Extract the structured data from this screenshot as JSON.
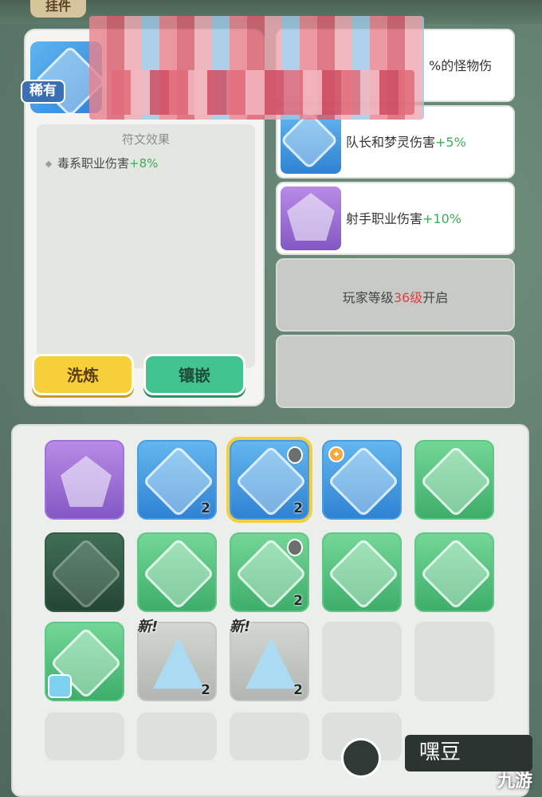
{
  "top": {
    "tab_label": "挂件"
  },
  "detail": {
    "rarity": "稀有",
    "effect_title": "符文效果",
    "effect_text": "毒系职业伤害",
    "effect_value": "+8%",
    "btn_refine": "洗炼",
    "btn_inlay": "镶嵌"
  },
  "slots": [
    {
      "text": "%的怪物伤",
      "value": ""
    },
    {
      "text": "队长和梦灵伤害",
      "value": "+5%"
    },
    {
      "text": "射手职业伤害",
      "value": "+10%"
    }
  ],
  "locked_slot": {
    "prefix": "玩家等级",
    "level": "36级",
    "suffix": "开启"
  },
  "inventory": {
    "row1": [
      {
        "type": "purple",
        "count": ""
      },
      {
        "type": "blue",
        "count": "2"
      },
      {
        "type": "blue",
        "count": "2"
      },
      {
        "type": "blue",
        "count": ""
      },
      {
        "type": "green",
        "count": ""
      }
    ],
    "row2": [
      {
        "type": "dark",
        "count": ""
      },
      {
        "type": "green",
        "count": ""
      },
      {
        "type": "green",
        "count": "2"
      },
      {
        "type": "green",
        "count": ""
      },
      {
        "type": "green",
        "count": ""
      }
    ],
    "row3": [
      {
        "type": "green",
        "count": ""
      },
      {
        "type": "gray",
        "count": "2",
        "new": "新!"
      },
      {
        "type": "gray",
        "count": "2",
        "new": "新!"
      }
    ]
  },
  "watermark": "九游",
  "watermark_dark": "嘿豆"
}
